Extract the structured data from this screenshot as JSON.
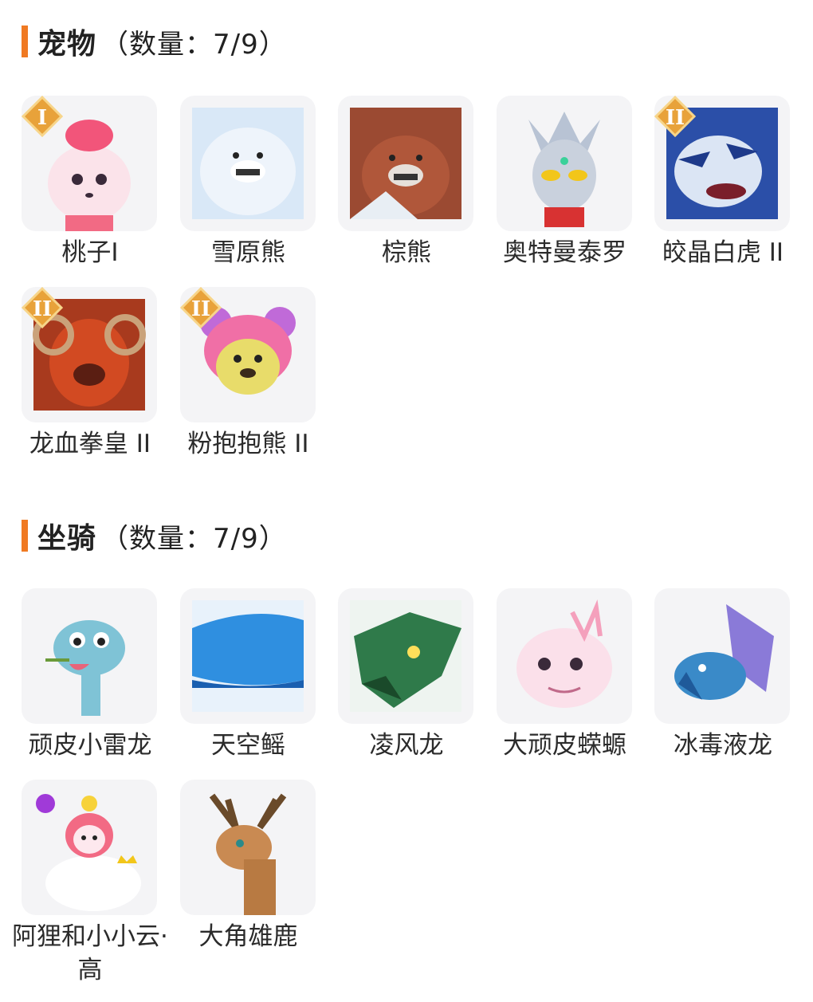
{
  "pets": {
    "title": "宠物",
    "count": "（数量：7/9）",
    "items": [
      {
        "name": "桃子I",
        "icon": "pink-fox-pet-icon",
        "badge": "I"
      },
      {
        "name": "雪原熊",
        "icon": "snow-bear-pet-icon",
        "badge": ""
      },
      {
        "name": "棕熊",
        "icon": "brown-bear-pet-icon",
        "badge": ""
      },
      {
        "name": "奥特曼泰罗",
        "icon": "ultraman-taro-pet-icon",
        "badge": ""
      },
      {
        "name": "皎晶白虎 II",
        "icon": "crystal-white-tiger-pet-icon",
        "badge": "II"
      },
      {
        "name": "龙血拳皇 II",
        "icon": "dragon-blood-fist-king-pet-icon",
        "badge": "II"
      },
      {
        "name": "粉抱抱熊 II",
        "icon": "pink-hug-bear-pet-icon",
        "badge": "II"
      }
    ]
  },
  "mounts": {
    "title": "坐骑",
    "count": "（数量：7/9）",
    "items": [
      {
        "name": "顽皮小雷龙",
        "icon": "naughty-little-dragon-mount-icon",
        "badge": ""
      },
      {
        "name": "天空鳐",
        "icon": "sky-ray-mount-icon",
        "badge": ""
      },
      {
        "name": "凌风龙",
        "icon": "wind-dragon-mount-icon",
        "badge": ""
      },
      {
        "name": "大顽皮蝾螈",
        "icon": "big-naughty-axolotl-mount-icon",
        "badge": ""
      },
      {
        "name": "冰毒液龙",
        "icon": "ice-venom-dragon-mount-icon",
        "badge": ""
      },
      {
        "name": "阿狸和小小云·高",
        "icon": "ali-and-little-cloud-mount-icon",
        "badge": ""
      },
      {
        "name": "大角雄鹿",
        "icon": "big-antler-stag-mount-icon",
        "badge": ""
      }
    ]
  },
  "colors": {
    "accent": "#f07a23",
    "tile_bg": "#f4f4f6",
    "badge": "#e8a23a"
  }
}
